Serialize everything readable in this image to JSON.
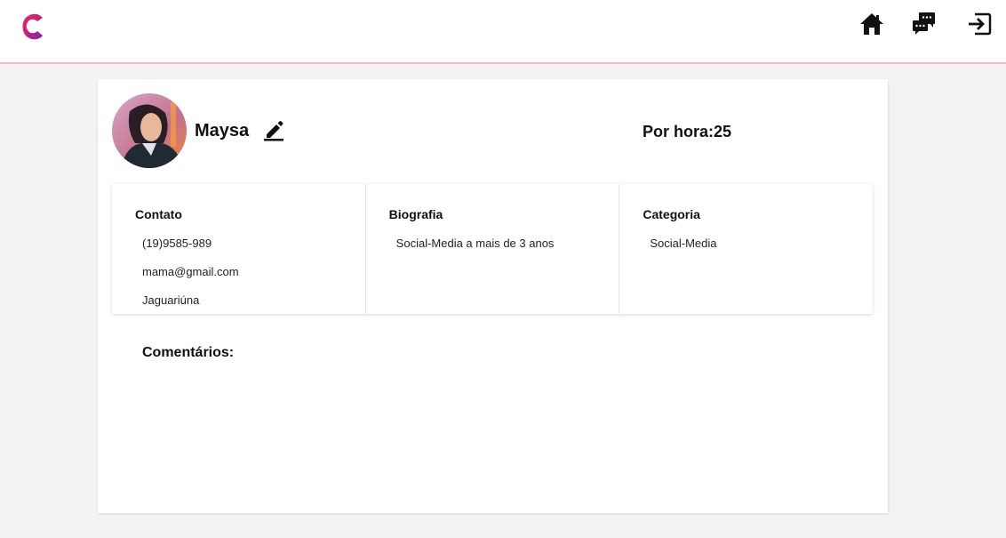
{
  "header": {
    "logo_icon": "brand-c-logo",
    "nav": [
      {
        "icon": "home-icon"
      },
      {
        "icon": "chat-icon"
      },
      {
        "icon": "logout-icon"
      }
    ],
    "accent_color": "#f4b9cb",
    "brand_gradient": [
      "#e9285f",
      "#8a1fa6"
    ]
  },
  "profile": {
    "name": "Maysa",
    "rate_label": "Por hora:25",
    "avatar_icon": "avatar-portrait"
  },
  "sections": {
    "contact": {
      "title": "Contato",
      "phone": "(19)9585-989",
      "email": "mama@gmail.com",
      "city": "Jaguariúna"
    },
    "bio": {
      "title": "Biografia",
      "text": "Social-Media a mais de 3 anos"
    },
    "category": {
      "title": "Categoria",
      "text": "Social-Media"
    }
  },
  "comments": {
    "title": "Comentários:"
  }
}
